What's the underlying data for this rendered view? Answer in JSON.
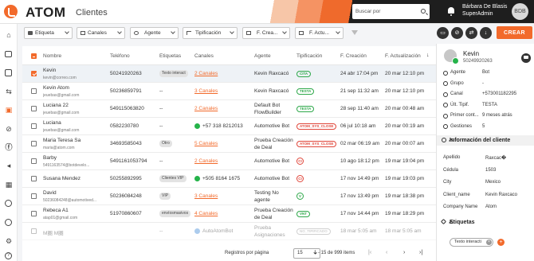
{
  "header": {
    "logo": "ATOM",
    "page_title": "Clientes",
    "search_placeholder": "Buscar por",
    "user_name": "Bárbara De Blasis",
    "user_role": "SuperAdmin",
    "avatar_initials": "BDB"
  },
  "sidebar": {
    "icons": [
      "home-icon",
      "chat-icon",
      "table-icon",
      "sync-icon",
      "contacts-icon",
      "no-user-icon",
      "facebook-icon",
      "megaphone-icon",
      "apps-icon",
      "globe-icon",
      "clock-icon",
      "settings-icon",
      "help-icon"
    ],
    "active": "contacts-icon"
  },
  "filters": {
    "etiqueta": "Etiqueta",
    "canales": "Canales",
    "agente": "Agente",
    "tipificacion": "Tipificación",
    "f_creacion": "F. Crea...",
    "f_actualizacion": "F. Actu...",
    "create_label": "CREAR"
  },
  "table": {
    "columns": {
      "nombre": "Nombre",
      "telefono": "Teléfono",
      "etiquetas": "Etiquetas",
      "canales": "Canales",
      "agente": "Agente",
      "tipificacion": "Tipificación",
      "f_creacion": "F. Creación",
      "f_actualizacion": "F. Actualización"
    },
    "rows": [
      {
        "name": "Kevin",
        "email": "kevin@correo.com",
        "phone": "50241920263",
        "tag": "Texto interact",
        "channel": "2 Canales",
        "channel_link": true,
        "agent": "Kevin Raxcacó",
        "agent2": "",
        "tip": "CITA",
        "tip_kind": "pill",
        "tip_color": "#2ea84a",
        "created": "24 abr 17:04 pm",
        "updated": "20 mar 12:10 pm",
        "checked": true
      },
      {
        "name": "Kevin Atom",
        "email": "jeuebas@gmail.com",
        "phone": "50236859791",
        "tag": "--",
        "channel": "3 Canales",
        "channel_link": true,
        "agent": "Kevin Raxcacó",
        "agent2": "",
        "tip": "TESTA",
        "tip_kind": "pill",
        "tip_color": "#2ea84a",
        "created": "21 sep 11:32 am",
        "updated": "20 mar 12:10 pm"
      },
      {
        "name": "Luciana 22",
        "email": "jeuebas@gmail.com",
        "phone": "549115063820",
        "tag": "--",
        "channel": "2 Canales",
        "channel_link": true,
        "agent": "Default Bot",
        "agent2": "FlowBuilder",
        "tip": "TESTA",
        "tip_kind": "pill",
        "tip_color": "#2ea84a",
        "created": "28 sep 11:40 am",
        "updated": "20 mar 00:48 am"
      },
      {
        "name": "Luciana",
        "email": "jeuebas@gmail.com",
        "phone": "0582230780",
        "tag": "--",
        "channel": "+57 318 8212013",
        "channel_wa": true,
        "agent": "Automotive Bot",
        "agent2": "",
        "tip": "ATOM_SYS_CLOSE",
        "tip_kind": "pill",
        "tip_color": "#e0463a",
        "created": "06 jul 10:18 am",
        "updated": "20 mar 00:19 am"
      },
      {
        "name": "Maria Teresa Sa",
        "email": "maria@atom.com",
        "phone": "34693585043",
        "tag": "Otro",
        "channel": "5 Canales",
        "channel_link": true,
        "agent": "Prueba Creación",
        "agent2": "de Deal",
        "tip": "ATOM_SYS_CLOSE",
        "tip_kind": "pill",
        "tip_color": "#e0463a",
        "created": "02 mar 06:19 am",
        "updated": "20 mar 00:07 am"
      },
      {
        "name": "Barby",
        "email": "5491163574@botdevelo...",
        "phone": "5491161053794",
        "tag": "--",
        "channel": "2 Canales",
        "channel_link": true,
        "agent": "Automotive Bot",
        "agent2": "",
        "tip": "CI",
        "tip_kind": "circle",
        "tip_color": "#e0463a",
        "created": "10 ago 18:12 pm",
        "updated": "19 mar 19:04 pm"
      },
      {
        "name": "Susana Mendez",
        "email": "",
        "phone": "50255892995",
        "tag": "Clientes VIP",
        "channel": "+505 8164 1675",
        "channel_wa": true,
        "agent": "Automotive Bot",
        "agent2": "",
        "tip": "CI",
        "tip_kind": "circle",
        "tip_color": "#e0463a",
        "created": "17 nov 14:49 pm",
        "updated": "19 mar 19:03 pm"
      },
      {
        "name": "David",
        "email": "50236084248@automotived...",
        "phone": "50236084248",
        "tag": "VIP",
        "channel": "3 Canales",
        "channel_link": true,
        "agent": "Testing No",
        "agent2": "agente",
        "tip": "V",
        "tip_kind": "circle",
        "tip_color": "#2ea84a",
        "created": "17 nov 13:49 pm",
        "updated": "19 mar 18:38 pm"
      },
      {
        "name": "Rebeca A1",
        "email": "atap01@gmail.com",
        "phone": "51970860607",
        "tag": "envíosmasivos",
        "channel": "4 Canales",
        "channel_link": true,
        "agent": "Prueba Creación",
        "agent2": "de Deal",
        "tip": "VNT",
        "tip_kind": "pill",
        "tip_color": "#2ea84a",
        "created": "17 nov 14:44 pm",
        "updated": "19 mar 18:29 pm"
      },
      {
        "name": "M圈 M圈",
        "email": "",
        "phone": "",
        "tag": "--",
        "channel": "AutoAtomBot",
        "channel_bot": true,
        "agent": "Prueba",
        "agent2": "Asignaciones",
        "tip": "NO_TIPIFICADO",
        "tip_kind": "pill",
        "tip_color": "#999999",
        "created": "18 mar 5:05 am",
        "updated": "18 mar 5:05 am",
        "disabled": true
      }
    ]
  },
  "pagination": {
    "rows_per_page_label": "Registros por página",
    "rows_per_page": "15",
    "range": "1 - 15 de 999 items"
  },
  "panel": {
    "name": "Kevin",
    "phone": "50249920263",
    "fields": [
      {
        "key": "Agente",
        "value": "Bot"
      },
      {
        "key": "Grupo",
        "value": "-"
      },
      {
        "key": "Canal",
        "value": "+573001182295"
      },
      {
        "key": "Últ. Tipif.",
        "value": "TESTA"
      },
      {
        "key": "Primer cont...",
        "value": "9 meses atrás"
      },
      {
        "key": "Gestiones",
        "value": "5"
      }
    ],
    "info_title": "Información del cliente",
    "info_fields": [
      {
        "key": "Apellido",
        "value": "Raxcac�"
      },
      {
        "key": "Cédula",
        "value": "1503"
      },
      {
        "key": "City",
        "value": "Mexico"
      },
      {
        "key": "Client_name",
        "value": "Kevin Raxcaco"
      },
      {
        "key": "Company Name",
        "value": "Atom"
      }
    ],
    "tags_title": "Etiquetas",
    "tag": "Texto interacti"
  },
  "colors": {
    "accent": "#f26a2b",
    "header_dark": "#1e1e1e",
    "whatsapp": "#25b34a"
  }
}
